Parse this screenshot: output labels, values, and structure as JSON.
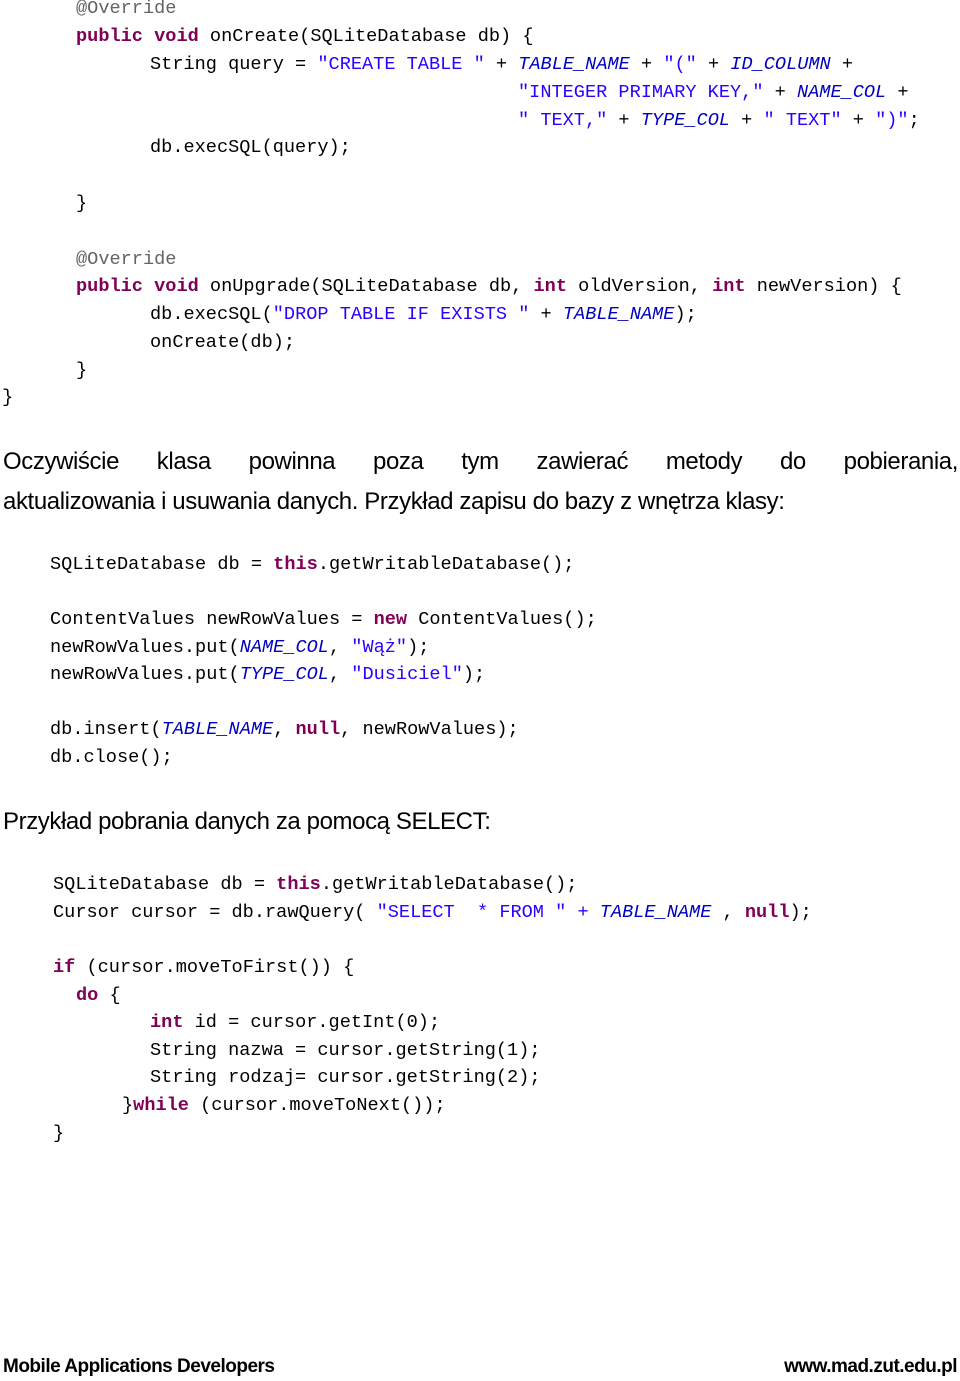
{
  "document": {
    "code_block_1": {
      "lines": [
        {
          "segments": [
            {
              "t": "@Override",
              "c": "ann"
            }
          ]
        },
        {
          "segments": [
            {
              "t": "public",
              "c": "kw"
            },
            {
              "t": " "
            },
            {
              "t": "void",
              "c": "kw"
            },
            {
              "t": " onCreate(SQLiteDatabase db) {"
            }
          ]
        },
        {
          "segments": [
            {
              "t": "String query = "
            },
            {
              "t": "\"CREATE TABLE \"",
              "c": "str"
            },
            {
              "t": " + "
            },
            {
              "t": "TABLE_NAME",
              "c": "const"
            },
            {
              "t": " + "
            },
            {
              "t": "\"(\"",
              "c": "str"
            },
            {
              "t": " + "
            },
            {
              "t": "ID_COLUMN",
              "c": "const"
            },
            {
              "t": " +"
            }
          ]
        },
        {
          "segments": [
            {
              "t": "\"INTEGER PRIMARY KEY,\"",
              "c": "str"
            },
            {
              "t": " + "
            },
            {
              "t": "NAME_COL",
              "c": "const"
            },
            {
              "t": " +"
            }
          ]
        },
        {
          "segments": [
            {
              "t": "\" TEXT,\"",
              "c": "str"
            },
            {
              "t": " + "
            },
            {
              "t": "TYPE_COL",
              "c": "const"
            },
            {
              "t": " + "
            },
            {
              "t": "\" TEXT\"",
              "c": "str"
            },
            {
              "t": " + "
            },
            {
              "t": "\")\"",
              "c": "str"
            },
            {
              "t": ";"
            }
          ]
        },
        {
          "segments": [
            {
              "t": "db.execSQL(query);"
            }
          ]
        },
        {
          "segments": [
            {
              "t": "}"
            }
          ]
        },
        {
          "segments": [
            {
              "t": "@Override",
              "c": "ann"
            }
          ]
        },
        {
          "segments": [
            {
              "t": "public",
              "c": "kw"
            },
            {
              "t": " "
            },
            {
              "t": "void",
              "c": "kw"
            },
            {
              "t": " onUpgrade(SQLiteDatabase db, "
            },
            {
              "t": "int",
              "c": "kw"
            },
            {
              "t": " oldVersion, "
            },
            {
              "t": "int",
              "c": "kw"
            },
            {
              "t": " newVersion) {"
            }
          ]
        },
        {
          "segments": [
            {
              "t": "db.execSQL("
            },
            {
              "t": "\"DROP TABLE IF EXISTS \"",
              "c": "str"
            },
            {
              "t": " + "
            },
            {
              "t": "TABLE_NAME",
              "c": "const"
            },
            {
              "t": ");"
            }
          ]
        },
        {
          "segments": [
            {
              "t": "onCreate(db);"
            }
          ]
        },
        {
          "segments": [
            {
              "t": "}"
            }
          ]
        },
        {
          "segments": [
            {
              "t": "}"
            }
          ]
        }
      ]
    },
    "paragraph_1": {
      "line1": "Oczywiście klasa powinna poza tym zawierać metody do pobierania,",
      "line2": "aktualizowania i usuwania danych. Przykład zapisu do bazy z wnętrza klasy:"
    },
    "code_block_2": {
      "lines": [
        {
          "segments": [
            {
              "t": "SQLiteDatabase db = "
            },
            {
              "t": "this",
              "c": "kw"
            },
            {
              "t": ".getWritableDatabase();"
            }
          ]
        },
        {
          "segments": [
            {
              "t": "ContentValues newRowValues = "
            },
            {
              "t": "new",
              "c": "kw"
            },
            {
              "t": " ContentValues();"
            }
          ]
        },
        {
          "segments": [
            {
              "t": "newRowValues.put("
            },
            {
              "t": "NAME_COL",
              "c": "const"
            },
            {
              "t": ", "
            },
            {
              "t": "\"Wąż\"",
              "c": "str"
            },
            {
              "t": ");"
            }
          ]
        },
        {
          "segments": [
            {
              "t": "newRowValues.put("
            },
            {
              "t": "TYPE_COL",
              "c": "const"
            },
            {
              "t": ", "
            },
            {
              "t": "\"Dusiciel\"",
              "c": "str"
            },
            {
              "t": ");"
            }
          ]
        },
        {
          "segments": [
            {
              "t": "db.insert("
            },
            {
              "t": "TABLE_NAME",
              "c": "const"
            },
            {
              "t": ", "
            },
            {
              "t": "null",
              "c": "kw"
            },
            {
              "t": ", newRowValues);"
            }
          ]
        },
        {
          "segments": [
            {
              "t": "db.close();"
            }
          ]
        }
      ]
    },
    "heading_select": "Przykład pobrania danych za pomocą SELECT:",
    "code_block_3": {
      "lines": [
        {
          "segments": [
            {
              "t": "SQLiteDatabase db = "
            },
            {
              "t": "this",
              "c": "kw"
            },
            {
              "t": ".getWritableDatabase();"
            }
          ]
        },
        {
          "segments": [
            {
              "t": "Cursor cursor = db.rawQuery( "
            },
            {
              "t": "\"SELECT  * FROM \" + ",
              "c": "str"
            },
            {
              "t": "TABLE_NAME",
              "c": "const"
            },
            {
              "t": " , "
            },
            {
              "t": "null",
              "c": "kw"
            },
            {
              "t": ");"
            }
          ]
        },
        {
          "segments": [
            {
              "t": "if",
              "c": "kw"
            },
            {
              "t": " (cursor.moveToFirst()) {"
            }
          ]
        },
        {
          "segments": [
            {
              "t": "do",
              "c": "kw"
            },
            {
              "t": " {"
            }
          ]
        },
        {
          "segments": [
            {
              "t": "int",
              "c": "kw"
            },
            {
              "t": " id = cursor.getInt(0);"
            }
          ]
        },
        {
          "segments": [
            {
              "t": "String nazwa = cursor.getString(1);"
            }
          ]
        },
        {
          "segments": [
            {
              "t": "String rodzaj= cursor.getString(2);"
            }
          ]
        },
        {
          "segments": [
            {
              "t": "}"
            },
            {
              "t": "while",
              "c": "kw"
            },
            {
              "t": " (cursor.moveToNext());"
            }
          ]
        },
        {
          "segments": [
            {
              "t": "}"
            }
          ]
        }
      ]
    },
    "footer": {
      "left": "Mobile Applications Developers",
      "right": "www.mad.zut.edu.pl"
    },
    "colors": {
      "keyword": "#7f0055",
      "string": "#2a00ff",
      "constant": "#0000c0",
      "annotation": "#646464",
      "text": "#000000"
    }
  }
}
